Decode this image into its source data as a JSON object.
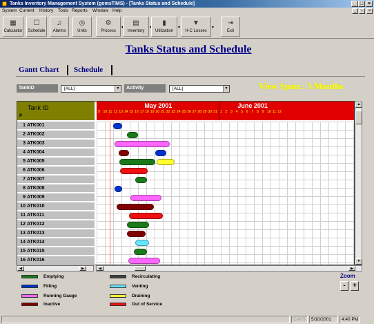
{
  "window": {
    "title": "Tanks Inventory Management System (gomsTIMS) - [Tanks Status and Schedule]"
  },
  "menu": [
    "System",
    "Current",
    "History",
    "Tools",
    "Reports",
    "Window",
    "Help"
  ],
  "toolbar": [
    {
      "label": "Calculator",
      "icon": "calculator-icon",
      "glyph": "▦"
    },
    {
      "label": "Schedule",
      "icon": "schedule-icon",
      "glyph": "☐"
    },
    {
      "label": "Alarms",
      "icon": "alarm-bell-icon",
      "glyph": "♫"
    },
    {
      "label": "Units",
      "icon": "units-icon",
      "glyph": "◎"
    },
    {
      "label": "Process",
      "icon": "process-icon",
      "glyph": "⚙"
    },
    {
      "label": "Inventory",
      "icon": "inventory-icon",
      "glyph": "▤"
    },
    {
      "label": "Utilization",
      "icon": "utilization-chart-icon",
      "glyph": "▮"
    },
    {
      "label": "H-C Losses",
      "icon": "losses-icon",
      "glyph": "▼"
    },
    {
      "label": "Exit",
      "icon": "exit-icon",
      "glyph": "⇥"
    }
  ],
  "page": {
    "title": "Tanks Status and Schedule",
    "tabs": [
      "Gantt Chart",
      "Schedule"
    ],
    "filters": {
      "tank_label": "TankID",
      "tank_value": "[ALL]",
      "activity_label": "Activity",
      "activity_value": "[ALL]"
    },
    "view_span": "View Span : 3 Months"
  },
  "gantt": {
    "header_label": "Tank ID",
    "header_hash": "#",
    "months": [
      {
        "name": "May 2001",
        "days": [
          "9",
          "10",
          "11",
          "12",
          "13",
          "14",
          "15",
          "16",
          "17",
          "18",
          "19",
          "20",
          "21",
          "22",
          "23",
          "24",
          "25",
          "26",
          "27",
          "28",
          "29",
          "30",
          "31"
        ]
      },
      {
        "name": "June 2001",
        "days": [
          "1",
          "2",
          "3",
          "4",
          "5",
          "6",
          "7",
          "8",
          "9",
          "10",
          "11",
          "12"
        ]
      }
    ],
    "rows": [
      {
        "num": "1",
        "tank": "ATK001"
      },
      {
        "num": "2",
        "tank": "ATK002"
      },
      {
        "num": "3",
        "tank": "ATK003"
      },
      {
        "num": "4",
        "tank": "ATK004"
      },
      {
        "num": "5",
        "tank": "ATK005"
      },
      {
        "num": "6",
        "tank": "ATK006"
      },
      {
        "num": "7",
        "tank": "ATK007"
      },
      {
        "num": "8",
        "tank": "ATK008"
      },
      {
        "num": "9",
        "tank": "ATK009"
      },
      {
        "num": "10",
        "tank": "ATK010"
      },
      {
        "num": "11",
        "tank": "ATK011"
      },
      {
        "num": "12",
        "tank": "ATK012"
      },
      {
        "num": "13",
        "tank": "ATK013"
      },
      {
        "num": "14",
        "tank": "ATK014"
      },
      {
        "num": "15",
        "tank": "ATK015"
      },
      {
        "num": "16",
        "tank": "ATK016"
      }
    ],
    "bars": [
      {
        "row": 0,
        "start_day": 11.3,
        "end_day": 12.7,
        "status": "Filling"
      },
      {
        "row": 1,
        "start_day": 13.5,
        "end_day": 15.2,
        "status": "Emptying"
      },
      {
        "row": 2,
        "start_day": 11.5,
        "end_day": 20.0,
        "status": "Running Gauge"
      },
      {
        "row": 3,
        "start_day": 12.2,
        "end_day": 13.8,
        "status": "Inactive"
      },
      {
        "row": 3,
        "start_day": 17.8,
        "end_day": 19.5,
        "status": "Filling"
      },
      {
        "row": 4,
        "start_day": 12.3,
        "end_day": 17.8,
        "status": "Emptying"
      },
      {
        "row": 4,
        "start_day": 18.0,
        "end_day": 20.8,
        "status": "Draining"
      },
      {
        "row": 5,
        "start_day": 12.4,
        "end_day": 16.6,
        "status": "Out of Service"
      },
      {
        "row": 6,
        "start_day": 14.7,
        "end_day": 16.5,
        "status": "Emptying"
      },
      {
        "row": 7,
        "start_day": 11.5,
        "end_day": 12.7,
        "status": "Filling"
      },
      {
        "row": 8,
        "start_day": 14.0,
        "end_day": 18.8,
        "status": "Running Gauge"
      },
      {
        "row": 9,
        "start_day": 11.9,
        "end_day": 17.6,
        "status": "Inactive"
      },
      {
        "row": 10,
        "start_day": 13.8,
        "end_day": 19.0,
        "status": "Out of Service"
      },
      {
        "row": 11,
        "start_day": 13.5,
        "end_day": 16.8,
        "status": "Emptying"
      },
      {
        "row": 12,
        "start_day": 13.5,
        "end_day": 16.3,
        "status": "Inactive"
      },
      {
        "row": 13,
        "start_day": 14.7,
        "end_day": 16.8,
        "status": "Venting"
      },
      {
        "row": 14,
        "start_day": 14.5,
        "end_day": 16.5,
        "status": "Emptying"
      },
      {
        "row": 15,
        "start_day": 13.7,
        "end_day": 18.5,
        "status": "Running Gauge"
      }
    ]
  },
  "legend": [
    {
      "label": "Emptying",
      "color": "#1a7a1a"
    },
    {
      "label": "Filling",
      "color": "#0033cc"
    },
    {
      "label": "Running Gauge",
      "color": "#ff66ff"
    },
    {
      "label": "Inactive",
      "color": "#800000"
    },
    {
      "label": "Recirculating",
      "color": "#404040"
    },
    {
      "label": "Venting",
      "color": "#66e6ff"
    },
    {
      "label": "Draining",
      "color": "#ffff33"
    },
    {
      "label": "Out of Service",
      "color": "#ee1111"
    }
  ],
  "zoom": {
    "label": "Zoom",
    "minus": "-",
    "plus": "+"
  },
  "status": {
    "caps": "CAPS",
    "date": "5/10/2001",
    "time": "4:40 PM"
  }
}
